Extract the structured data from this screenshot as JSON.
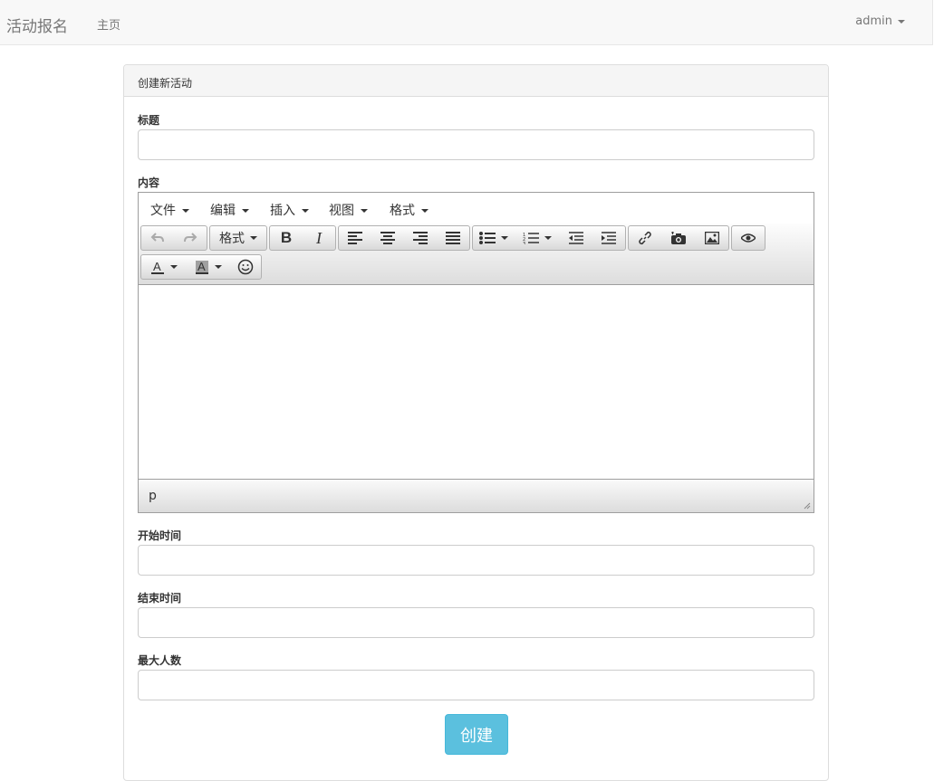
{
  "navbar": {
    "brand": "活动报名",
    "home": "主页",
    "user": "admin"
  },
  "panel": {
    "heading": "创建新活动"
  },
  "form": {
    "title_label": "标题",
    "content_label": "内容",
    "start_label": "开始时间",
    "end_label": "结束时间",
    "max_label": "最大人数",
    "submit_label": "创建"
  },
  "editor": {
    "menus": [
      "文件",
      "编辑",
      "插入",
      "视图",
      "格式"
    ],
    "format_label": "格式",
    "statusbar_path": "p",
    "toolbar_icons": [
      "undo-icon",
      "redo-icon",
      "format-dropdown",
      "bold-icon",
      "italic-icon",
      "align-left-icon",
      "align-center-icon",
      "align-right-icon",
      "align-justify-icon",
      "bullet-list-icon",
      "numbered-list-icon",
      "outdent-icon",
      "indent-icon",
      "link-icon",
      "camera-icon",
      "image-icon",
      "preview-eye-icon",
      "text-color-icon",
      "background-color-icon",
      "emoticon-icon"
    ]
  },
  "colors": {
    "navbar_bg": "#f8f8f8",
    "button_info": "#5bc0de",
    "panel_heading_bg": "#f5f5f5"
  }
}
